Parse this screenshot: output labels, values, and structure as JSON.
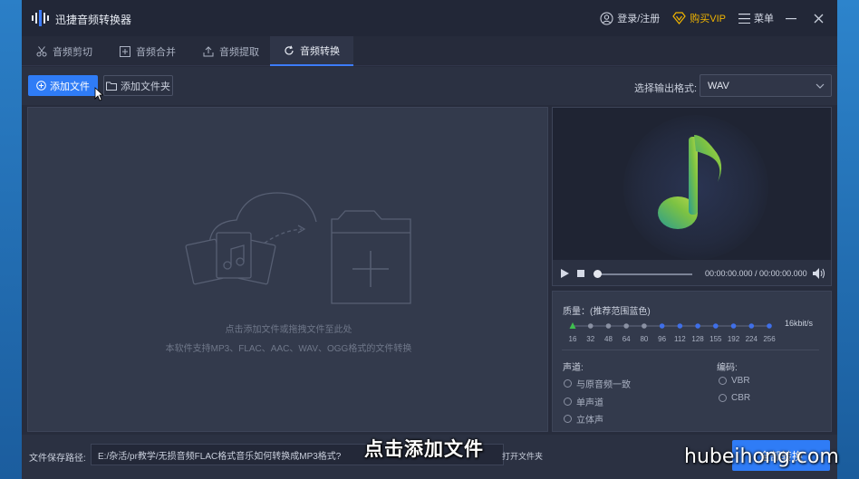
{
  "app": {
    "title": "迅捷音频转换器"
  },
  "titlebar": {
    "login_label": "登录/注册",
    "vip_label": "购买VIP",
    "menu_label": "菜单"
  },
  "tabs": [
    {
      "label": "音频剪切",
      "icon": "scissors-icon"
    },
    {
      "label": "音频合并",
      "icon": "merge-icon"
    },
    {
      "label": "音频提取",
      "icon": "upload-icon"
    },
    {
      "label": "音频转换",
      "icon": "refresh-icon",
      "active": true
    }
  ],
  "toolbar": {
    "add_file_label": "添加文件",
    "add_folder_label": "添加文件夹",
    "format_label": "选择输出格式:",
    "format_value": "WAV"
  },
  "dropzone": {
    "hint_line1": "点击添加文件或拖拽文件至此处",
    "hint_line2": "本软件支持MP3、FLAC、AAC、WAV、OGG格式的文件转换"
  },
  "player": {
    "time": "00:00:00.000 / 00:00:00.000",
    "progress": 0
  },
  "settings": {
    "quality_label": "质量：(推荐范围蓝色)",
    "bitrate_ticks": [
      "16",
      "32",
      "48",
      "64",
      "80",
      "96",
      "112",
      "128",
      "155",
      "192",
      "224",
      "256"
    ],
    "bitrate_value": "16kbit/s",
    "channel_label": "声道:",
    "channel_options": [
      "与原音频一致",
      "单声道",
      "立体声"
    ],
    "encoding_label": "编码:",
    "encoding_options": [
      "VBR",
      "CBR"
    ]
  },
  "footer": {
    "save_label": "文件保存路径:",
    "save_path": "E:/杂活/pr教学/无损音频FLAC格式音乐如何转换成MP3格式?",
    "open_folder_label": "打开文件夹",
    "convert_label": "全部转换"
  },
  "overlay": {
    "subtitle": "点击添加文件",
    "watermark": "hubeihong.com"
  },
  "colors": {
    "accent": "#2f7cf6",
    "vip": "#f0b400",
    "slider_green": "#3fbf4f",
    "slider_blue": "#3f6fe8"
  }
}
